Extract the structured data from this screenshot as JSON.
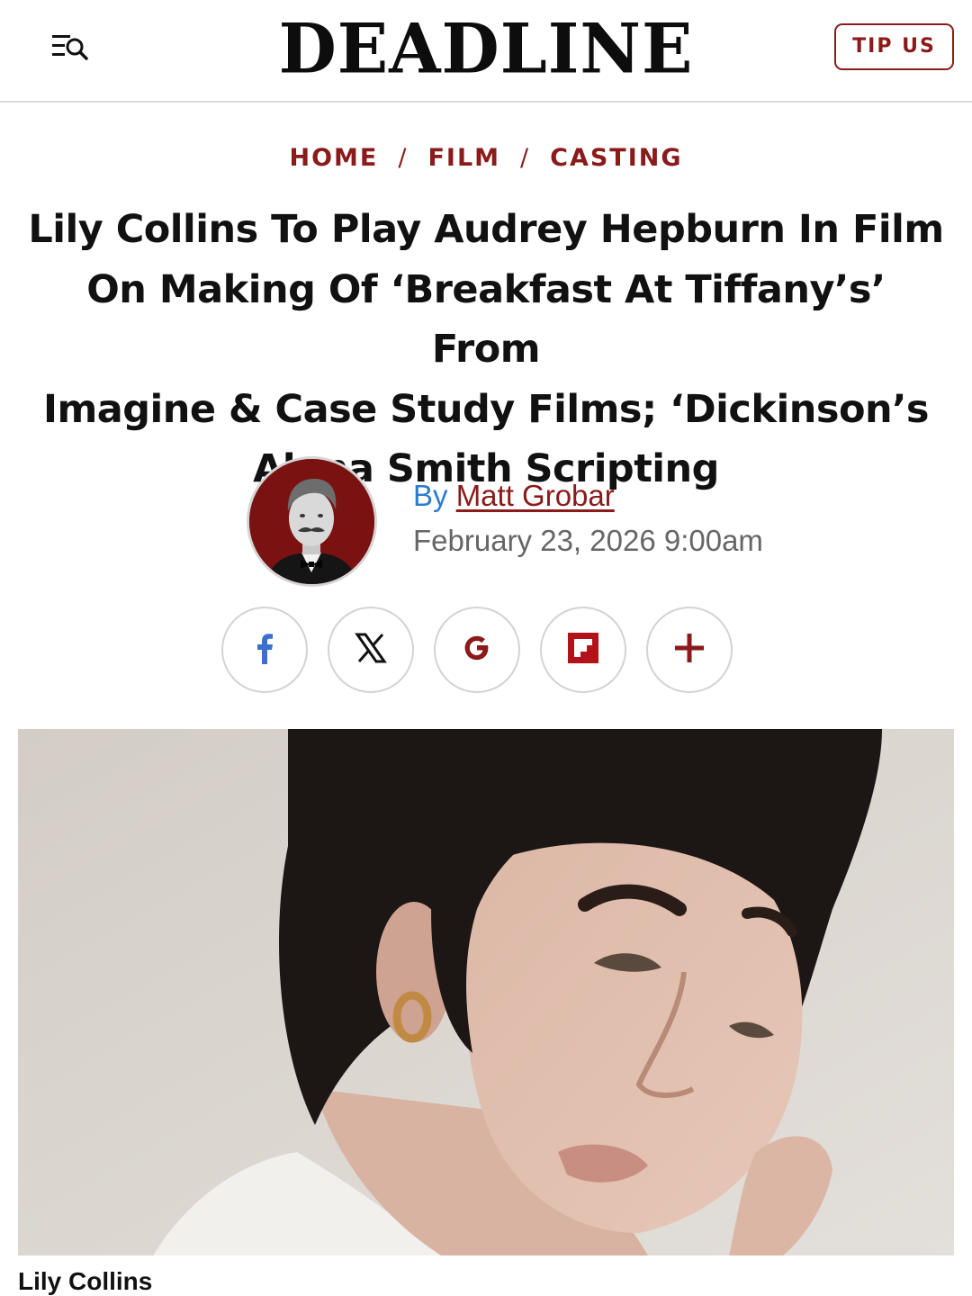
{
  "header": {
    "logo": "DEADLINE",
    "tip_label": "TIP US",
    "menu_icon": "menu-search-icon"
  },
  "breadcrumb": [
    {
      "label": "HOME"
    },
    {
      "label": "FILM"
    },
    {
      "label": "CASTING"
    }
  ],
  "breadcrumb_separator": "/",
  "article": {
    "headline_lines": [
      "Lily Collins To Play Audrey Hepburn In Film",
      "On Making Of ‘Breakfast At Tiffany’s’ From",
      "Imagine & Case Study Films; ‘Dickinson’s",
      "Alena Smith Scripting"
    ],
    "by_label": "By",
    "author": "Matt Grobar",
    "date": "February 23, 2026 9:00am",
    "caption": "Lily Collins"
  },
  "share": [
    {
      "icon": "facebook-icon"
    },
    {
      "icon": "x-icon"
    },
    {
      "icon": "google-icon"
    },
    {
      "icon": "flipboard-icon"
    },
    {
      "icon": "plus-icon"
    }
  ],
  "colors": {
    "accent": "#8b1a1a",
    "byline_blue": "#2b7bd0",
    "date_gray": "#666666",
    "facebook": "#3b6fd0"
  }
}
